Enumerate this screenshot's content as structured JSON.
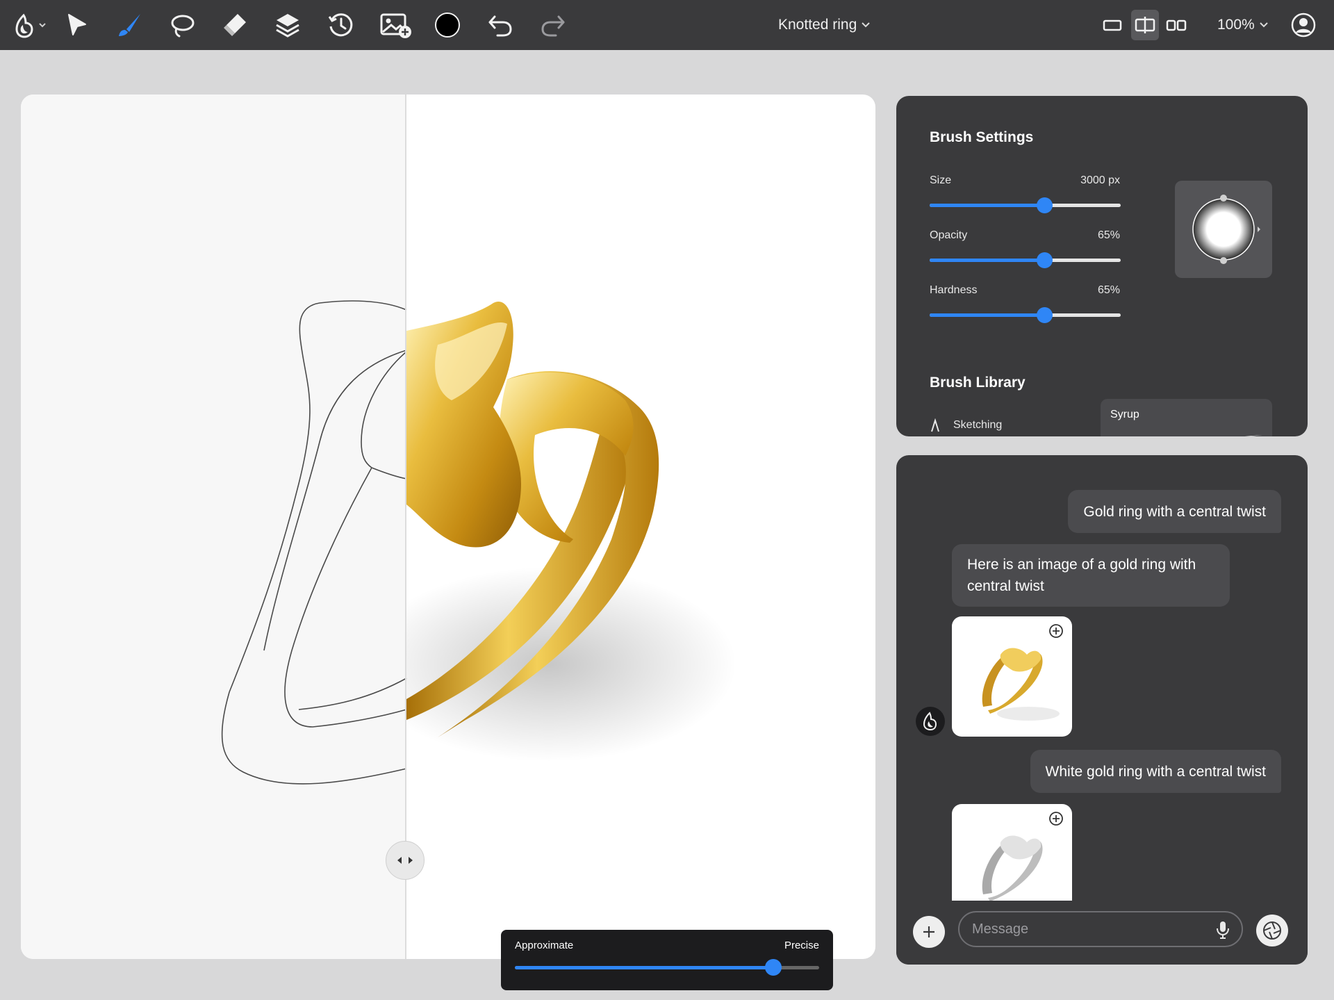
{
  "toolbar": {
    "tools": [
      "app-menu",
      "select",
      "brush",
      "lasso",
      "eraser",
      "layers",
      "history",
      "add-image",
      "color",
      "undo",
      "redo"
    ],
    "brush_color": "#2f86f6",
    "color_swatch": "#000000",
    "document_title": "Knotted ring",
    "zoom": "100%"
  },
  "canvas": {
    "split_position": 0.45,
    "precision": {
      "left_label": "Approximate",
      "right_label": "Precise",
      "value": 0.85
    }
  },
  "brush_settings": {
    "title": "Brush Settings",
    "sliders": [
      {
        "label": "Size",
        "value_text": "3000 px",
        "value": 0.6
      },
      {
        "label": "Opacity",
        "value_text": "65%",
        "value": 0.6
      },
      {
        "label": "Hardness",
        "value_text": "65%",
        "value": 0.6
      }
    ],
    "library_title": "Brush Library",
    "library_items": [
      "Sketching"
    ],
    "featured_brush": "Syrup"
  },
  "chat": {
    "messages": [
      {
        "role": "user",
        "text": "Gold ring with a central twist"
      },
      {
        "role": "assistant",
        "text": "Here is an image of a gold ring with central twist"
      },
      {
        "role": "user",
        "text": "White gold ring with a central twist"
      }
    ],
    "input_placeholder": "Message"
  },
  "colors": {
    "accent": "#2f86f6",
    "panel": "#3a3a3c",
    "gold": "#d9a829"
  }
}
